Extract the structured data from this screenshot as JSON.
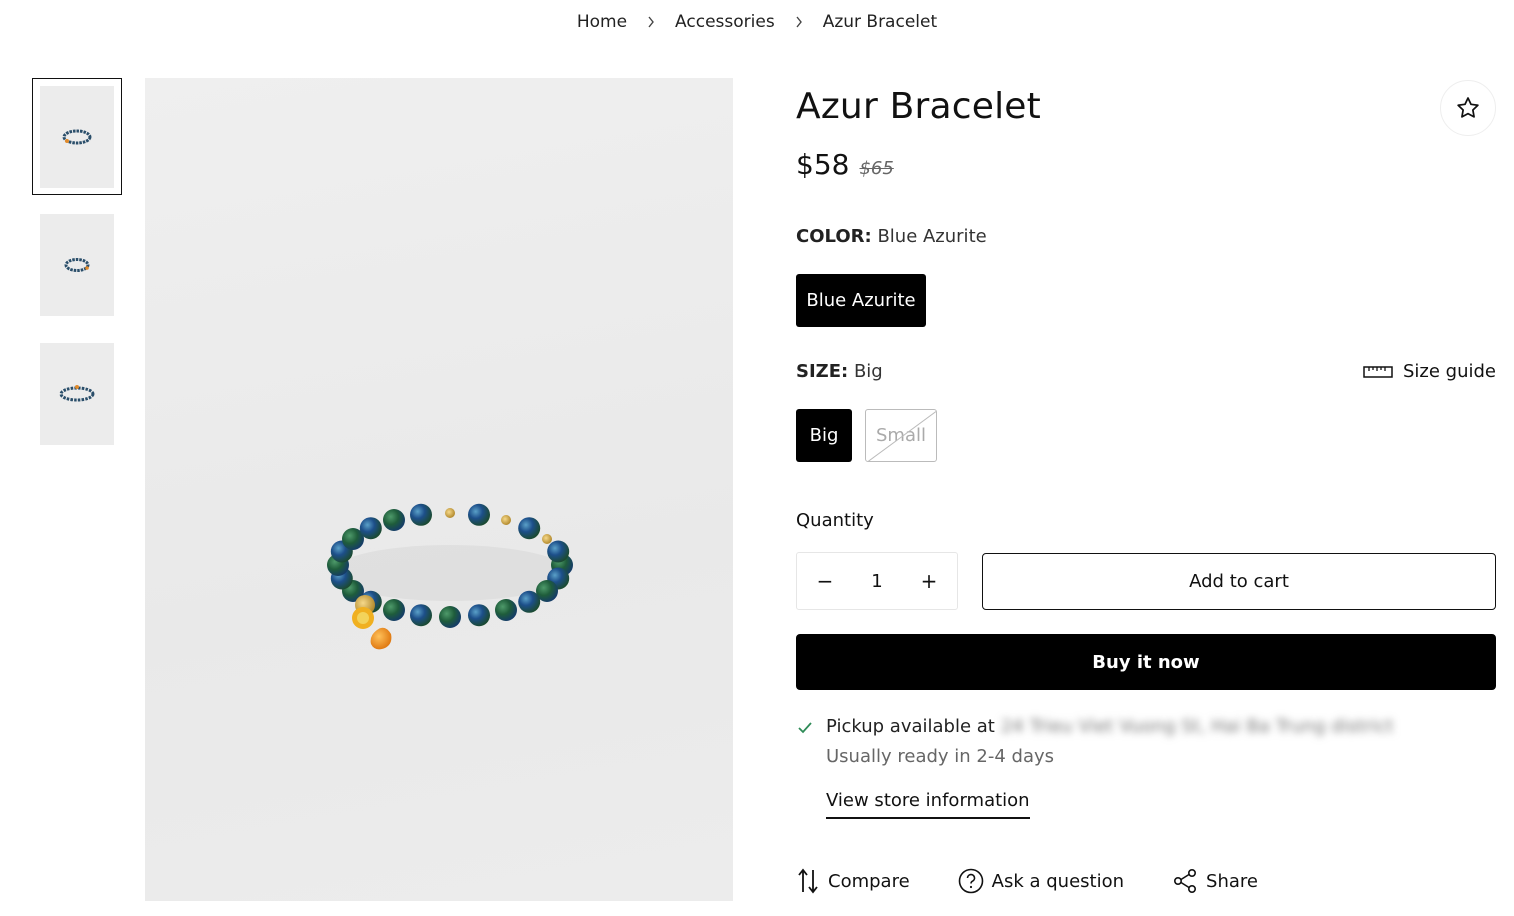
{
  "breadcrumb": {
    "items": [
      "Home",
      "Accessories",
      "Azur Bracelet"
    ],
    "separator_icon": "chevron-right-icon"
  },
  "product": {
    "title": "Azur Bracelet",
    "price": "$58",
    "compare_price": "$65"
  },
  "color": {
    "label": "COLOR:",
    "selected": "Blue Azurite",
    "options": [
      {
        "label": "Blue Azurite",
        "selected": true,
        "available": true
      }
    ]
  },
  "size": {
    "label": "SIZE:",
    "selected": "Big",
    "size_guide_label": "Size guide",
    "options": [
      {
        "label": "Big",
        "selected": true,
        "available": true
      },
      {
        "label": "Small",
        "selected": false,
        "available": false
      }
    ]
  },
  "quantity": {
    "label": "Quantity",
    "value": "1",
    "minus": "−",
    "plus": "+"
  },
  "buttons": {
    "add_to_cart": "Add to cart",
    "buy_now": "Buy it now"
  },
  "pickup": {
    "available_text": "Pickup available at",
    "location_blurred": "24 Trieu Viet Vuong St, Hai Ba Trung district",
    "ready_text": "Usually ready in 2-4 days",
    "store_link": "View store information"
  },
  "actions": [
    {
      "label": "Compare",
      "icon": "compare-arrows-icon"
    },
    {
      "label": "Ask a question",
      "icon": "question-circle-icon"
    },
    {
      "label": "Share",
      "icon": "share-icon"
    }
  ],
  "colors": {
    "primary": "#000000",
    "background": "#ffffff",
    "image_bg": "#ececec",
    "check": "#2e8b57"
  }
}
